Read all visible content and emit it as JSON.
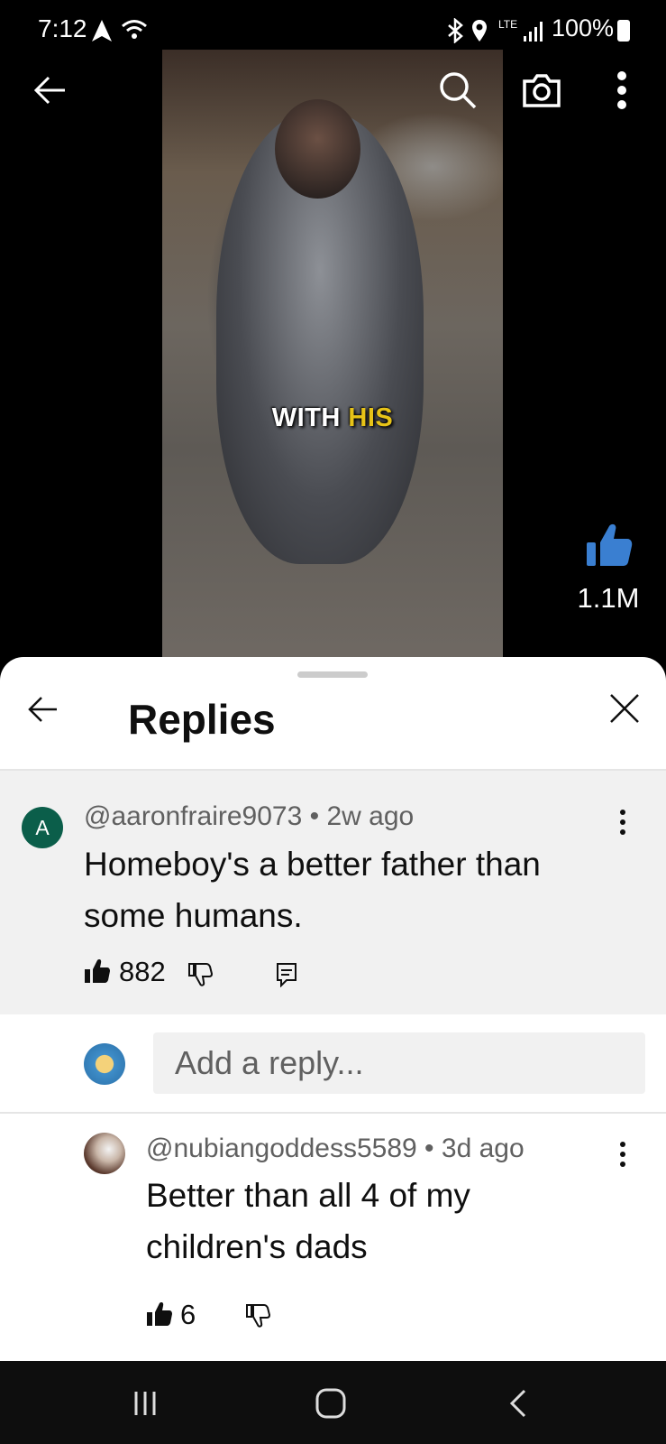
{
  "status_bar": {
    "time": "7:12",
    "network": "LTE",
    "battery": "100%"
  },
  "video": {
    "caption_word1": "WITH",
    "caption_word2": "HIS",
    "like_count": "1.1M"
  },
  "replies_sheet": {
    "title": "Replies",
    "main_comment": {
      "avatar_letter": "A",
      "author": "@aaronfraire9073",
      "age": "2w ago",
      "text_line1": "Homeboy's a better father than",
      "text_line2": "some humans.",
      "likes": "882"
    },
    "add_reply_placeholder": "Add a reply...",
    "reply": {
      "author": "@nubiangoddess5589",
      "age": "3d ago",
      "text_line1": "Better than all 4 of my",
      "text_line2": "children's dads",
      "likes": "6"
    }
  },
  "colors": {
    "caption_highlight": "#e7c318",
    "like_blue": "#3a7fd1",
    "avatar_green": "#0b5e4a"
  }
}
